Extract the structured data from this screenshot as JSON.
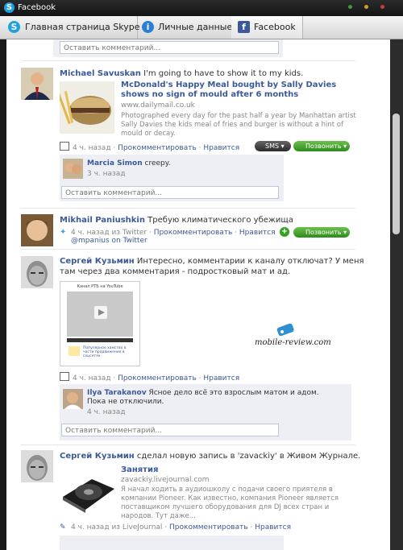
{
  "window": {
    "title": "Facebook"
  },
  "tabs": [
    {
      "label": "Главная страница Skype"
    },
    {
      "label": "Личные данные"
    },
    {
      "label": "Facebook"
    }
  ],
  "comment_placeholder": "Оставить комментарий...",
  "posts": [
    {
      "author": "Michael Savuskan",
      "text": "I'm going to have to show it to my kids.",
      "link_title": "McDonald's Happy Meal bought by Sally Davies shows no sign of mould after 6 months",
      "link_url": "www.dailymail.co.uk",
      "link_desc": "Photographed every day for the past half a year by Manhattan artist Sally Davies the kids meal of fries and burger is without a hint of mould or decay.",
      "time": "4 ч. назад",
      "comment_action": "Прокомментировать",
      "like_action": "Нравится",
      "sms_label": "SMS",
      "call_label": "Позвонить",
      "comment": {
        "author": "Marcia Simon",
        "text": "creepy.",
        "time": "3 ч. назад"
      }
    },
    {
      "author": "Mikhail Paniushkin",
      "text": "Требую климатического убежища",
      "time": "4 ч. назад",
      "via": "из Twitter",
      "comment_action": "Прокомментировать",
      "like_action": "Нравится",
      "twitter_handle": "@mpanius on Twitter",
      "call_label": "Позвонить"
    },
    {
      "author": "Сергей Кузьмин",
      "text": "Интересно, комментарии к каналу отключат? У меня там через два комментария - подростковый мат и ад.",
      "time": "4 ч. назад",
      "comment_action": "Прокомментировать",
      "like_action": "Нравится",
      "thumb_title": "Канал РТБ на YouTube",
      "thumb_caption": "Популярное хамство в части продвижения в соцсетях",
      "comment": {
        "author": "Ilya Tarakanov",
        "text": "Ясное дело всё это взрослым матом и адом. Пока не отключили.",
        "time": "4 ч. назад"
      },
      "watermark": "mobile-review.com"
    },
    {
      "author": "Сергей Кузьмин",
      "text": "сделал новую запись в 'zavackiy' в Живом Журнале.",
      "link_title": "Занятия",
      "link_url": "zavackiy.livejournal.com",
      "link_desc": "Я начал ходить в аудиошколу с подачи своего приятеля в компании Pioneer. Как известно, компания Pioneer является поставщиком лучшего оборудования для DJ всех стран и народов. Тут даже...",
      "time": "4 ч. назад",
      "via": "из LiveJournal",
      "comment_action": "Прокомментировать",
      "like_action": "Нравится"
    }
  ],
  "colors": {
    "link": "#3b5998",
    "call_green": "#35a020",
    "skype_blue": "#1da1e0"
  }
}
